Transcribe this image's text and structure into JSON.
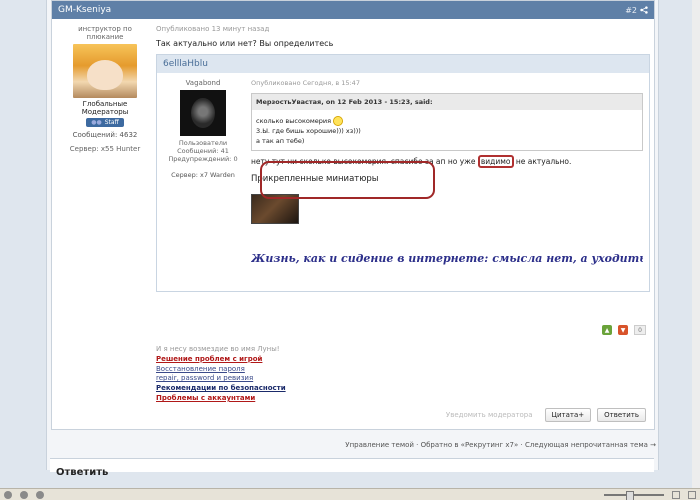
{
  "post": {
    "author": "GM-Kseniya",
    "number": "#2",
    "author_title": "инструктор по плюкание",
    "group": "Глобальные Модераторы",
    "badge": "Staff",
    "messages": "Сообщений: 4632",
    "server": "Сервер: x55 Hunter",
    "date": "Опубликовано 13 минут назад",
    "text": "Так актуально или нет? Вы определитесь"
  },
  "quote": {
    "author": "6elllaHblu",
    "nick": "Vagabond",
    "group": "Пользователи",
    "messages": "Сообщений: 41",
    "warnings": "Предупреждений: 0",
    "server": "Сервер: x7 Warden",
    "date": "Опубликовано Сегодня, в 15:47",
    "nested_head": "МерзостьУвастая, on 12 Feb 2013 - 15:23, said:",
    "nested_line1": "сколько высокомерия",
    "nested_line2": "3.Ы. где бишь хорошие))) хз)))",
    "nested_line3": "а так ап тебе)",
    "reply_before": "нету тут ни сколько высокомерия. спасибо за ап но уже ",
    "reply_highlight": "видимо",
    "reply_after": " не актуально.",
    "attachments_title": "Прикрепленные миниатюры",
    "signature": "Жизнь, как и сидение в интернете: смысла нет, а уходить не хочется"
  },
  "votes": {
    "count": "0"
  },
  "signature_links": {
    "intro": "И я несу возмездие во имя Луны!",
    "link1": "Решение проблем с игрой",
    "link2": "Восстановление пароля",
    "link3": "repair, password и ревизия",
    "link4": "Рекомендации по безопасности",
    "link5": "Проблемы с аккаунтами"
  },
  "actions": {
    "notify": "Уведомить модератора",
    "quote": "Цитата+",
    "reply": "Ответить"
  },
  "nav": {
    "text": "Управление темой · Обратно в «Рекрутинг x7» · Следующая непрочитанная тема →"
  },
  "reply_panel": {
    "title": "Ответить"
  }
}
